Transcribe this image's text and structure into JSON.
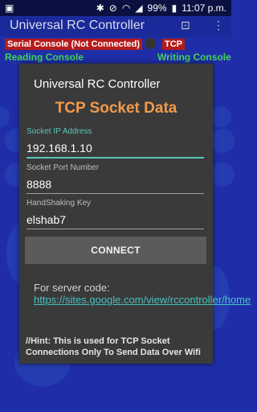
{
  "status_bar": {
    "battery": "99%",
    "time": "11:07 p.m."
  },
  "app": {
    "title": "Universal RC Controller",
    "serial_console": "Serial Console (Not Connected)",
    "tcp_label": "TCP",
    "reading_console": "Reading Console",
    "writing_console": "Writing Console"
  },
  "dialog": {
    "title": "Universal RC Controller",
    "heading": "TCP Socket Data",
    "ip_label": "Socket IP Address",
    "ip_value": "192.168.1.10",
    "port_label": "Socket Port Number",
    "port_value": "8888",
    "key_label": "HandShaking Key",
    "key_value": "elshab7",
    "connect_label": "CONNECT",
    "server_text": "For server code:",
    "server_link": "https://sites.google.com/view/rccontroller/home",
    "hint": "//Hint: This is used for TCP Socket Connections Only To Send Data Over Wifi"
  }
}
